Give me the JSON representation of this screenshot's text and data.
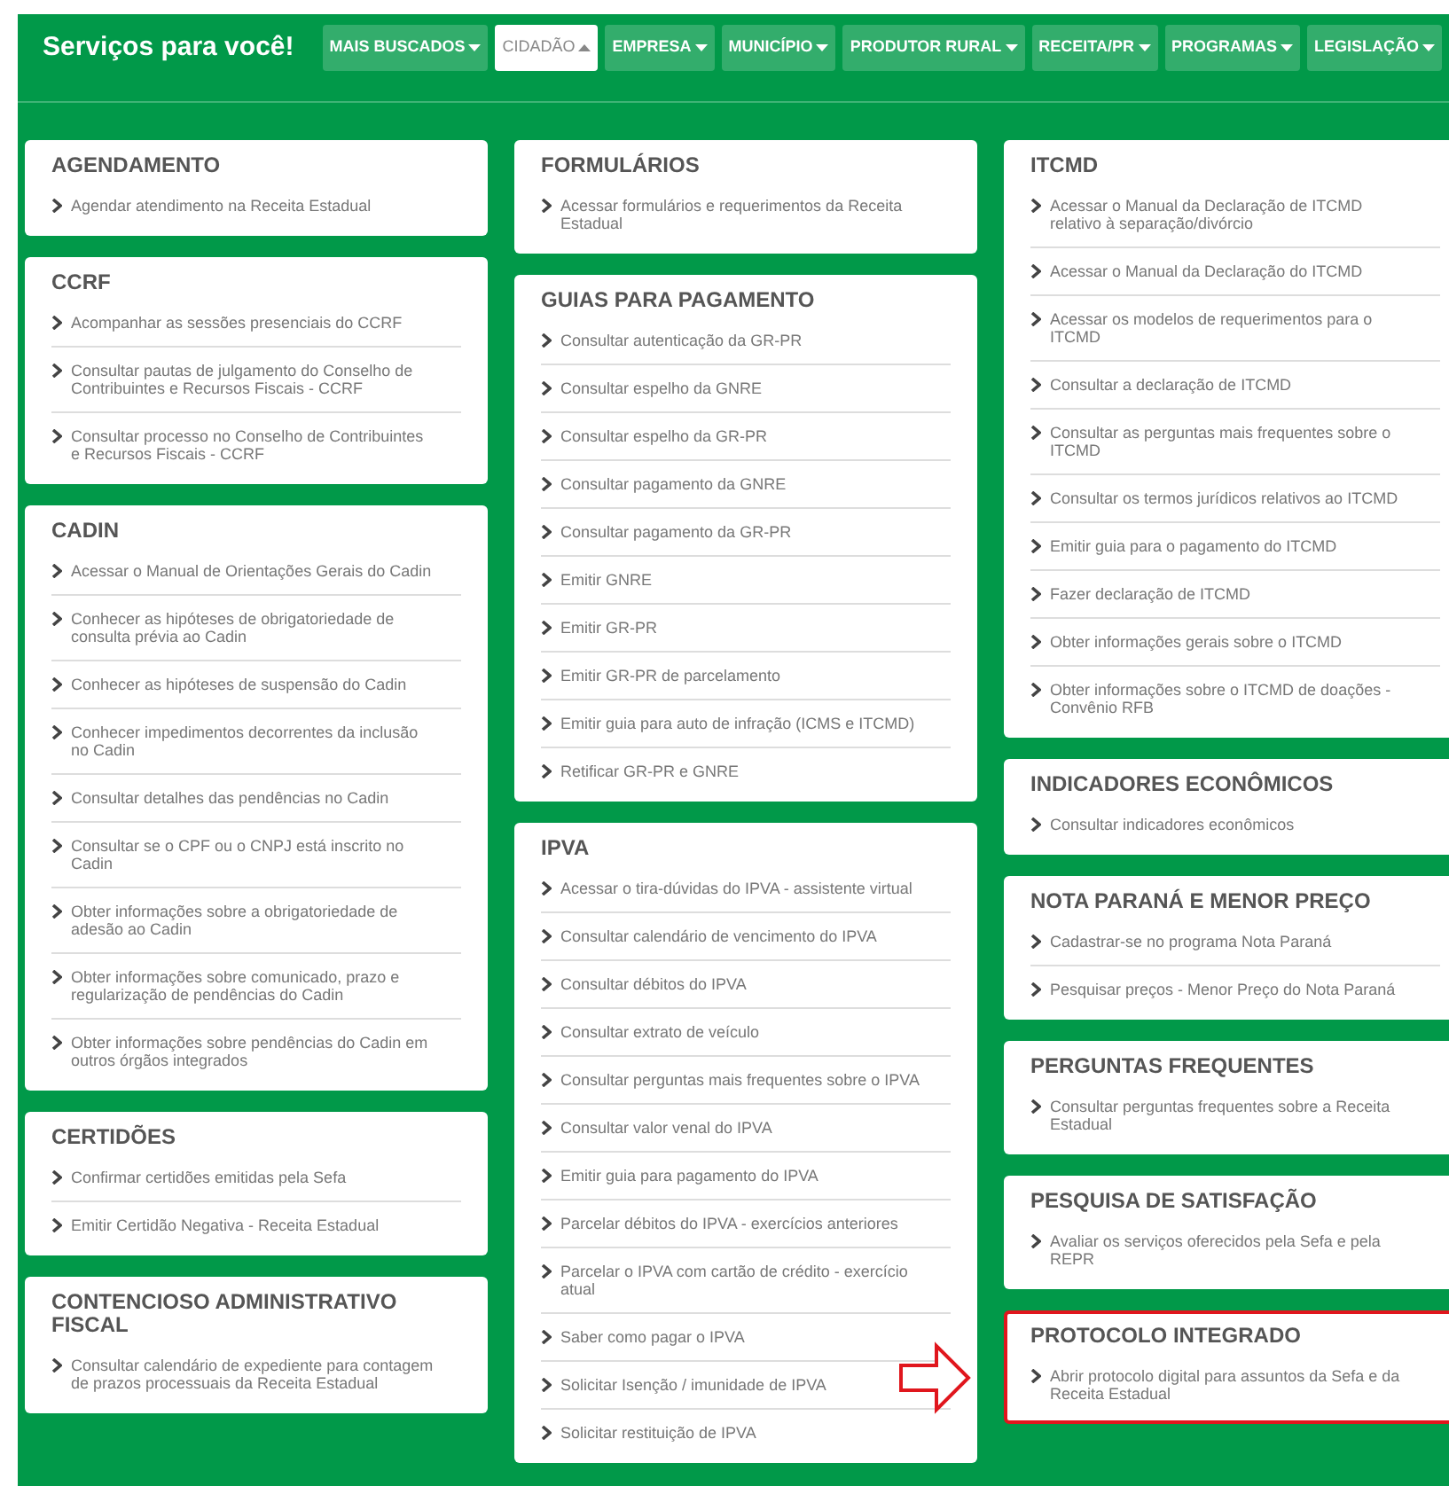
{
  "header": {
    "title": "Serviços para você!"
  },
  "nav": [
    {
      "label": "MAIS BUSCADOS",
      "selected": false
    },
    {
      "label": "CIDADÃO",
      "selected": true
    },
    {
      "label": "EMPRESA",
      "selected": false
    },
    {
      "label": "MUNICÍPIO",
      "selected": false
    },
    {
      "label": "PRODUTOR RURAL",
      "selected": false
    },
    {
      "label": "RECEITA/PR",
      "selected": false
    },
    {
      "label": "PROGRAMAS",
      "selected": false
    },
    {
      "label": "LEGISLAÇÃO",
      "selected": false
    }
  ],
  "columns": [
    [
      {
        "title": "AGENDAMENTO",
        "highlighted": false,
        "items": [
          "Agendar atendimento na Receita Estadual"
        ]
      },
      {
        "title": "CCRF",
        "highlighted": false,
        "items": [
          "Acompanhar as sessões presenciais do CCRF",
          "Consultar pautas de julgamento do Conselho de Contribuintes e Recursos Fiscais - CCRF",
          "Consultar processo no Conselho de Contribuintes e Recursos Fiscais - CCRF"
        ]
      },
      {
        "title": "CADIN",
        "highlighted": false,
        "items": [
          "Acessar o Manual de Orientações Gerais do Cadin",
          "Conhecer as hipóteses de obrigatoriedade de consulta prévia ao Cadin",
          "Conhecer as hipóteses de suspensão do Cadin",
          "Conhecer impedimentos decorrentes da inclusão no Cadin",
          "Consultar detalhes das pendências no Cadin",
          "Consultar se o CPF ou o CNPJ está inscrito no Cadin",
          "Obter informações sobre a obrigatoriedade de adesão ao Cadin",
          "Obter informações sobre comunicado, prazo e regularização de pendências do Cadin",
          "Obter informações sobre pendências do Cadin em outros órgãos integrados"
        ]
      },
      {
        "title": "CERTIDÕES",
        "highlighted": false,
        "items": [
          "Confirmar certidões emitidas pela Sefa",
          "Emitir Certidão Negativa - Receita Estadual"
        ]
      },
      {
        "title": "CONTENCIOSO ADMINISTRATIVO FISCAL",
        "highlighted": false,
        "items": [
          "Consultar calendário de expediente para contagem de prazos processuais da Receita Estadual"
        ]
      }
    ],
    [
      {
        "title": "FORMULÁRIOS",
        "highlighted": false,
        "items": [
          "Acessar formulários e requerimentos da Receita Estadual"
        ]
      },
      {
        "title": "GUIAS PARA PAGAMENTO",
        "highlighted": false,
        "items": [
          "Consultar autenticação da GR-PR",
          "Consultar espelho da GNRE",
          "Consultar espelho da GR-PR",
          "Consultar pagamento da GNRE",
          "Consultar pagamento da GR-PR",
          "Emitir GNRE",
          "Emitir GR-PR",
          "Emitir GR-PR de parcelamento",
          "Emitir guia para auto de infração (ICMS e ITCMD)",
          "Retificar GR-PR e GNRE"
        ]
      },
      {
        "title": "IPVA",
        "highlighted": false,
        "items": [
          "Acessar o tira-dúvidas do IPVA - assistente virtual",
          "Consultar calendário de vencimento do IPVA",
          "Consultar débitos do IPVA",
          "Consultar extrato de veículo",
          "Consultar perguntas mais frequentes sobre o IPVA",
          "Consultar valor venal do IPVA",
          "Emitir guia para pagamento do IPVA",
          "Parcelar débitos do IPVA - exercícios anteriores",
          "Parcelar o IPVA com cartão de crédito - exercício atual",
          "Saber como pagar o IPVA",
          "Solicitar Isenção / imunidade de IPVA",
          "Solicitar restituição de IPVA"
        ]
      }
    ],
    [
      {
        "title": "ITCMD",
        "highlighted": false,
        "items": [
          "Acessar o Manual da Declaração de ITCMD relativo à separação/divórcio",
          "Acessar o Manual da Declaração do ITCMD",
          "Acessar os modelos de requerimentos para o ITCMD",
          "Consultar a declaração de ITCMD",
          "Consultar as perguntas mais frequentes sobre o ITCMD",
          "Consultar os termos jurídicos relativos ao ITCMD",
          "Emitir guia para o pagamento do ITCMD",
          "Fazer declaração de ITCMD",
          "Obter informações gerais sobre o ITCMD",
          "Obter informações sobre o ITCMD de doações - Convênio RFB"
        ]
      },
      {
        "title": "INDICADORES ECONÔMICOS",
        "highlighted": false,
        "items": [
          "Consultar indicadores econômicos"
        ]
      },
      {
        "title": "NOTA PARANÁ E MENOR PREÇO",
        "highlighted": false,
        "items": [
          "Cadastrar-se no programa Nota Paraná",
          "Pesquisar preços - Menor Preço do Nota Paraná"
        ]
      },
      {
        "title": "PERGUNTAS FREQUENTES",
        "highlighted": false,
        "items": [
          "Consultar perguntas frequentes sobre a Receita Estadual"
        ]
      },
      {
        "title": "PESQUISA DE SATISFAÇÃO",
        "highlighted": false,
        "items": [
          "Avaliar os serviços oferecidos pela Sefa e pela REPR"
        ]
      },
      {
        "title": "PROTOCOLO INTEGRADO",
        "highlighted": true,
        "items": [
          "Abrir protocolo digital para assuntos da Sefa e da Receita Estadual"
        ]
      }
    ]
  ]
}
